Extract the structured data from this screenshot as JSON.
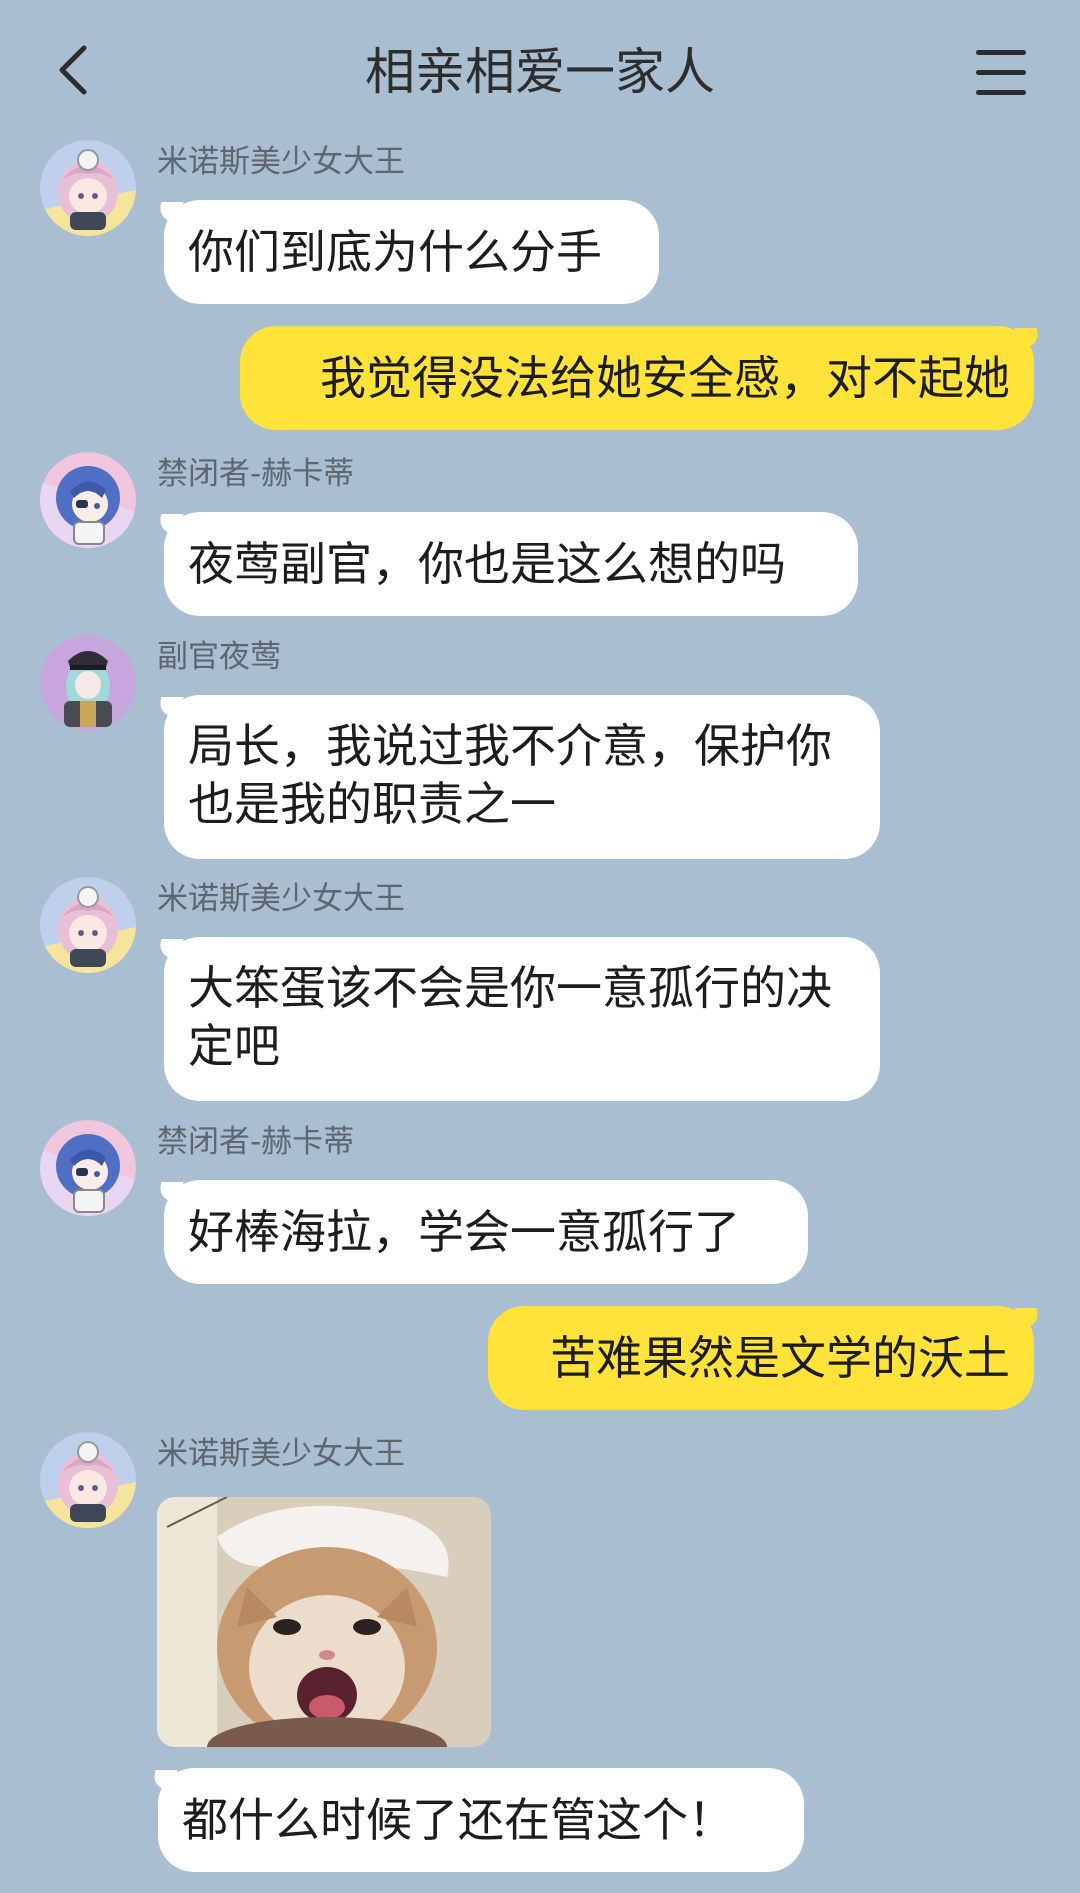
{
  "chat": {
    "title": "相亲相爱一家人",
    "back_icon": "chevron-left-icon",
    "menu_icon": "hamburger-menu-icon"
  },
  "colors": {
    "background": "#a9bed1",
    "incoming_bubble": "#ffffff",
    "outgoing_bubble": "#ffe33a",
    "sender_name": "#5e6670"
  },
  "messages": [
    {
      "sender": "米诺斯美少女大王",
      "text": "你们到底为什么分手"
    },
    {
      "sender": "",
      "text": "我觉得没法给她安全感，对不起她"
    },
    {
      "sender": "禁闭者-赫卡蒂",
      "text": "夜莺副官，你也是这么想的吗"
    },
    {
      "sender": "副官夜莺",
      "text": "局长，我说过我不介意，保护你也是我的职责之一"
    },
    {
      "sender": "米诺斯美少女大王",
      "text": "大笨蛋该不会是你一意孤行的决定吧"
    },
    {
      "sender": "禁闭者-赫卡蒂",
      "text": "好棒海拉，学会一意孤行了"
    },
    {
      "sender": "",
      "text": "苦难果然是文学的沃土"
    },
    {
      "sender": "米诺斯美少女大王",
      "text": ""
    },
    {
      "sender": "",
      "text": "都什么时候了还在管这个！"
    }
  ],
  "avatars": {
    "minos": "anime-girl-pink-hair-avatar",
    "hecate": "anime-girl-blue-hair-avatar",
    "nightingale": "anime-girl-military-cap-avatar"
  },
  "sticker": "crying-kitten-sticker"
}
